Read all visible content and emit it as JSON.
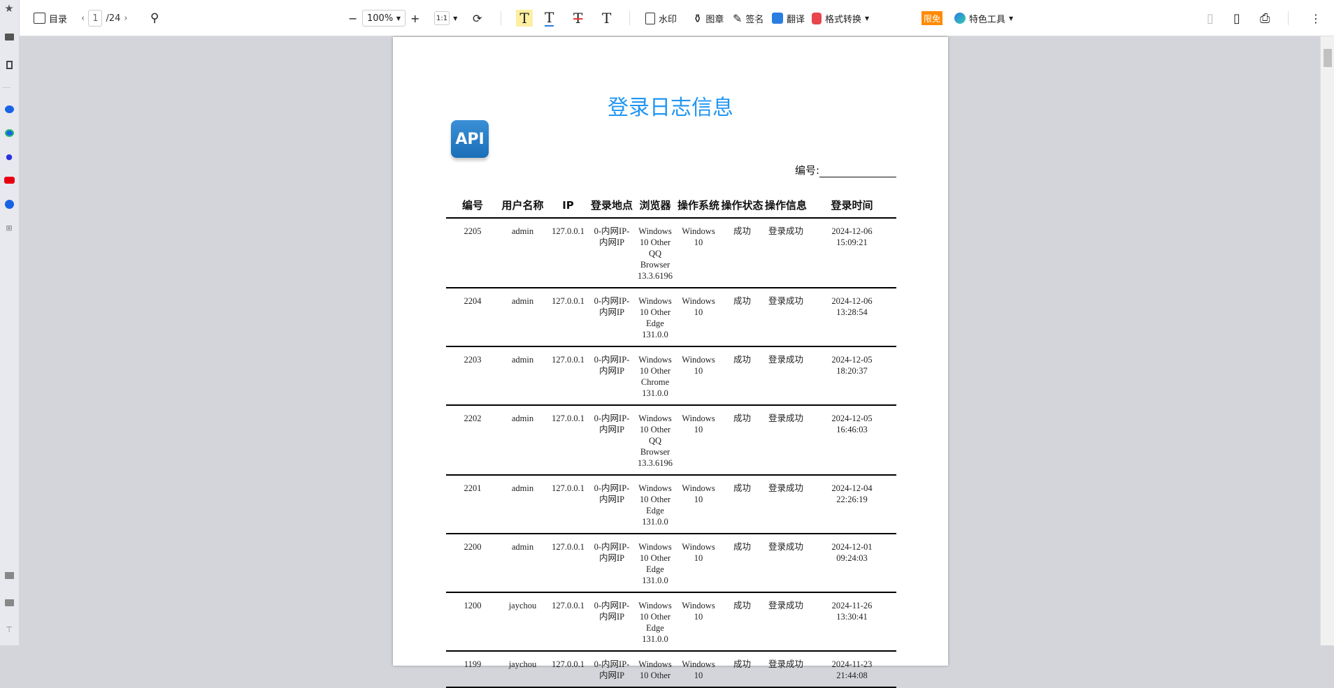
{
  "toolbar": {
    "toc": "目录",
    "page_current": "1",
    "page_total": "/24",
    "zoom": "100%",
    "fit": "1:1",
    "watermark": "水印",
    "stamp": "图章",
    "sign": "签名",
    "translate": "翻译",
    "convert": "格式转换",
    "badge": "限免",
    "tools": "特色工具"
  },
  "colors": {
    "title": "#2196f3",
    "badge": "#ff8a00"
  },
  "doc": {
    "title": "登录日志信息",
    "logo_text": "API",
    "number_label": "编号:",
    "headers": [
      "编号",
      "用户名称",
      "IP",
      "登录地点",
      "浏览器",
      "操作系统",
      "操作状态",
      "操作信息",
      "登录时间"
    ],
    "rows": [
      [
        "2205",
        "admin",
        "127.0.0.1",
        "0-内网IP-内网IP",
        "Windows 10 Other QQ Browser 13.3.6196",
        "Windows 10",
        "成功",
        "登录成功",
        "2024-12-06 15:09:21"
      ],
      [
        "2204",
        "admin",
        "127.0.0.1",
        "0-内网IP-内网IP",
        "Windows 10 Other Edge 131.0.0",
        "Windows 10",
        "成功",
        "登录成功",
        "2024-12-06 13:28:54"
      ],
      [
        "2203",
        "admin",
        "127.0.0.1",
        "0-内网IP-内网IP",
        "Windows 10 Other Chrome 131.0.0",
        "Windows 10",
        "成功",
        "登录成功",
        "2024-12-05 18:20:37"
      ],
      [
        "2202",
        "admin",
        "127.0.0.1",
        "0-内网IP-内网IP",
        "Windows 10 Other QQ Browser 13.3.6196",
        "Windows 10",
        "成功",
        "登录成功",
        "2024-12-05 16:46:03"
      ],
      [
        "2201",
        "admin",
        "127.0.0.1",
        "0-内网IP-内网IP",
        "Windows 10 Other Edge 131.0.0",
        "Windows 10",
        "成功",
        "登录成功",
        "2024-12-04 22:26:19"
      ],
      [
        "2200",
        "admin",
        "127.0.0.1",
        "0-内网IP-内网IP",
        "Windows 10 Other Edge 131.0.0",
        "Windows 10",
        "成功",
        "登录成功",
        "2024-12-01 09:24:03"
      ],
      [
        "1200",
        "jaychou",
        "127.0.0.1",
        "0-内网IP-内网IP",
        "Windows 10 Other Edge 131.0.0",
        "Windows 10",
        "成功",
        "登录成功",
        "2024-11-26 13:30:41"
      ],
      [
        "1199",
        "jaychou",
        "127.0.0.1",
        "0-内网IP-内网IP",
        "Windows 10 Other",
        "Windows 10",
        "成功",
        "登录成功",
        "2024-11-23 21:44:08"
      ]
    ]
  }
}
